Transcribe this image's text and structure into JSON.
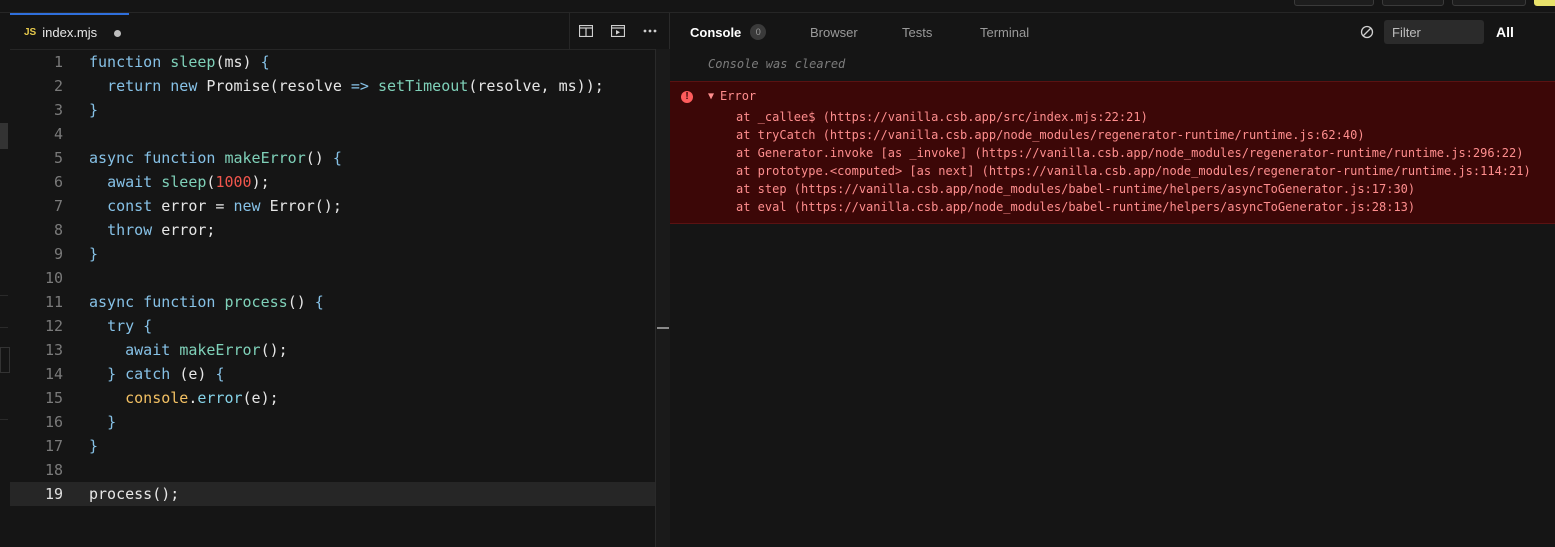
{
  "editor": {
    "tab": {
      "lang": "JS",
      "filename": "index.mjs"
    },
    "lines": [
      {
        "n": "1",
        "segments": [
          [
            "kw",
            "function "
          ],
          [
            "fn",
            "sleep"
          ],
          [
            "plain",
            "(ms) "
          ],
          [
            "kw",
            "{"
          ]
        ]
      },
      {
        "n": "2",
        "segments": [
          [
            "plain",
            "  "
          ],
          [
            "kw",
            "return new "
          ],
          [
            "plain",
            "Promise(resolve "
          ],
          [
            "kw",
            "=> "
          ],
          [
            "fn",
            "setTimeout"
          ],
          [
            "plain",
            "(resolve, ms));"
          ]
        ]
      },
      {
        "n": "3",
        "segments": [
          [
            "kw",
            "}"
          ]
        ]
      },
      {
        "n": "4",
        "segments": []
      },
      {
        "n": "5",
        "segments": [
          [
            "kw",
            "async function "
          ],
          [
            "fn",
            "makeError"
          ],
          [
            "plain",
            "() "
          ],
          [
            "kw",
            "{"
          ]
        ]
      },
      {
        "n": "6",
        "segments": [
          [
            "plain",
            "  "
          ],
          [
            "kw",
            "await "
          ],
          [
            "fn",
            "sleep"
          ],
          [
            "plain",
            "("
          ],
          [
            "num",
            "1000"
          ],
          [
            "plain",
            ");"
          ]
        ]
      },
      {
        "n": "7",
        "segments": [
          [
            "plain",
            "  "
          ],
          [
            "kw",
            "const "
          ],
          [
            "plain",
            "error = "
          ],
          [
            "kw",
            "new "
          ],
          [
            "plain",
            "Error();"
          ]
        ]
      },
      {
        "n": "8",
        "segments": [
          [
            "plain",
            "  "
          ],
          [
            "kw",
            "throw "
          ],
          [
            "plain",
            "error;"
          ]
        ]
      },
      {
        "n": "9",
        "segments": [
          [
            "kw",
            "}"
          ]
        ]
      },
      {
        "n": "10",
        "segments": []
      },
      {
        "n": "11",
        "segments": [
          [
            "kw",
            "async function "
          ],
          [
            "fn",
            "process"
          ],
          [
            "plain",
            "() "
          ],
          [
            "kw",
            "{"
          ]
        ]
      },
      {
        "n": "12",
        "segments": [
          [
            "plain",
            "  "
          ],
          [
            "kw",
            "try {"
          ]
        ]
      },
      {
        "n": "13",
        "segments": [
          [
            "plain",
            "    "
          ],
          [
            "kw",
            "await "
          ],
          [
            "fn",
            "makeError"
          ],
          [
            "plain",
            "();"
          ]
        ]
      },
      {
        "n": "14",
        "segments": [
          [
            "plain",
            "  "
          ],
          [
            "kw",
            "} catch "
          ],
          [
            "plain",
            "(e) "
          ],
          [
            "kw",
            "{"
          ]
        ]
      },
      {
        "n": "15",
        "segments": [
          [
            "plain",
            "    "
          ],
          [
            "obj",
            "console"
          ],
          [
            "plain",
            "."
          ],
          [
            "method",
            "error"
          ],
          [
            "plain",
            "(e);"
          ]
        ]
      },
      {
        "n": "16",
        "segments": [
          [
            "plain",
            "  "
          ],
          [
            "kw",
            "}"
          ]
        ]
      },
      {
        "n": "17",
        "segments": [
          [
            "kw",
            "}"
          ]
        ]
      },
      {
        "n": "18",
        "segments": []
      },
      {
        "n": "19",
        "segments": [
          [
            "plain",
            "process();"
          ]
        ],
        "current": true
      }
    ]
  },
  "pane": {
    "tabs": [
      {
        "label": "Console",
        "active": true,
        "badge": "0"
      },
      {
        "label": "Browser"
      },
      {
        "label": "Tests"
      },
      {
        "label": "Terminal"
      }
    ],
    "filter_placeholder": "Filter",
    "level": "All"
  },
  "console": {
    "cleared": "Console was cleared",
    "error": {
      "title": "Error",
      "frames": [
        "at _callee$ (https://vanilla.csb.app/src/index.mjs:22:21)",
        "at tryCatch (https://vanilla.csb.app/node_modules/regenerator-runtime/runtime.js:62:40)",
        "at Generator.invoke [as _invoke] (https://vanilla.csb.app/node_modules/regenerator-runtime/runtime.js:296:22)",
        "at prototype.<computed> [as next] (https://vanilla.csb.app/node_modules/regenerator-runtime/runtime.js:114:21)",
        "at step (https://vanilla.csb.app/node_modules/babel-runtime/helpers/asyncToGenerator.js:17:30)",
        "at eval (https://vanilla.csb.app/node_modules/babel-runtime/helpers/asyncToGenerator.js:28:13)"
      ]
    }
  }
}
